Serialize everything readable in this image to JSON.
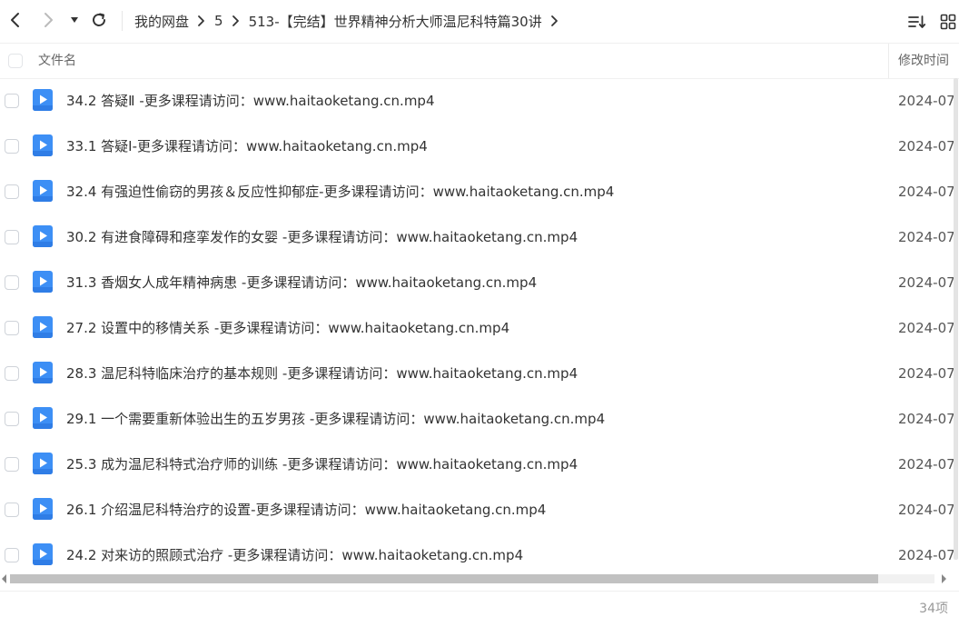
{
  "toolbar": {
    "breadcrumb": [
      "我的网盘",
      "5",
      "513-【完结】世界精神分析大师温尼科特篇30讲"
    ]
  },
  "columns": {
    "name": "文件名",
    "modified": "修改时间"
  },
  "files": [
    {
      "name": "34.2 答疑Ⅱ -更多课程请访问：www.haitaoketang.cn.mp4",
      "modified": "2024-07"
    },
    {
      "name": "33.1 答疑Ⅰ-更多课程请访问：www.haitaoketang.cn.mp4",
      "modified": "2024-07"
    },
    {
      "name": "32.4 有强迫性偷窃的男孩＆反应性抑郁症-更多课程请访问：www.haitaoketang.cn.mp4",
      "modified": "2024-07"
    },
    {
      "name": "30.2 有进食障碍和痉挛发作的女婴 -更多课程请访问：www.haitaoketang.cn.mp4",
      "modified": "2024-07"
    },
    {
      "name": "31.3 香烟女人成年精神病患 -更多课程请访问：www.haitaoketang.cn.mp4",
      "modified": "2024-07"
    },
    {
      "name": "27.2 设置中的移情关系 -更多课程请访问：www.haitaoketang.cn.mp4",
      "modified": "2024-07"
    },
    {
      "name": "28.3 温尼科特临床治疗的基本规则 -更多课程请访问：www.haitaoketang.cn.mp4",
      "modified": "2024-07"
    },
    {
      "name": "29.1 一个需要重新体验出生的五岁男孩 -更多课程请访问：www.haitaoketang.cn.mp4",
      "modified": "2024-07"
    },
    {
      "name": "25.3 成为温尼科特式治疗师的训练 -更多课程请访问：www.haitaoketang.cn.mp4",
      "modified": "2024-07"
    },
    {
      "name": "26.1 介绍温尼科特治疗的设置-更多课程请访问：www.haitaoketang.cn.mp4",
      "modified": "2024-07"
    },
    {
      "name": "24.2 对来访的照顾式治疗 -更多课程请访问：www.haitaoketang.cn.mp4",
      "modified": "2024-07"
    }
  ],
  "status": {
    "item_count": "34项"
  },
  "colors": {
    "video_icon": "#3d8ff5",
    "text": "#333333",
    "muted": "#999999"
  },
  "icons": [
    "back-icon",
    "forward-icon",
    "dropdown-icon",
    "refresh-icon",
    "chevron-right-icon",
    "sort-icon",
    "grid-view-icon",
    "video-file-icon"
  ]
}
